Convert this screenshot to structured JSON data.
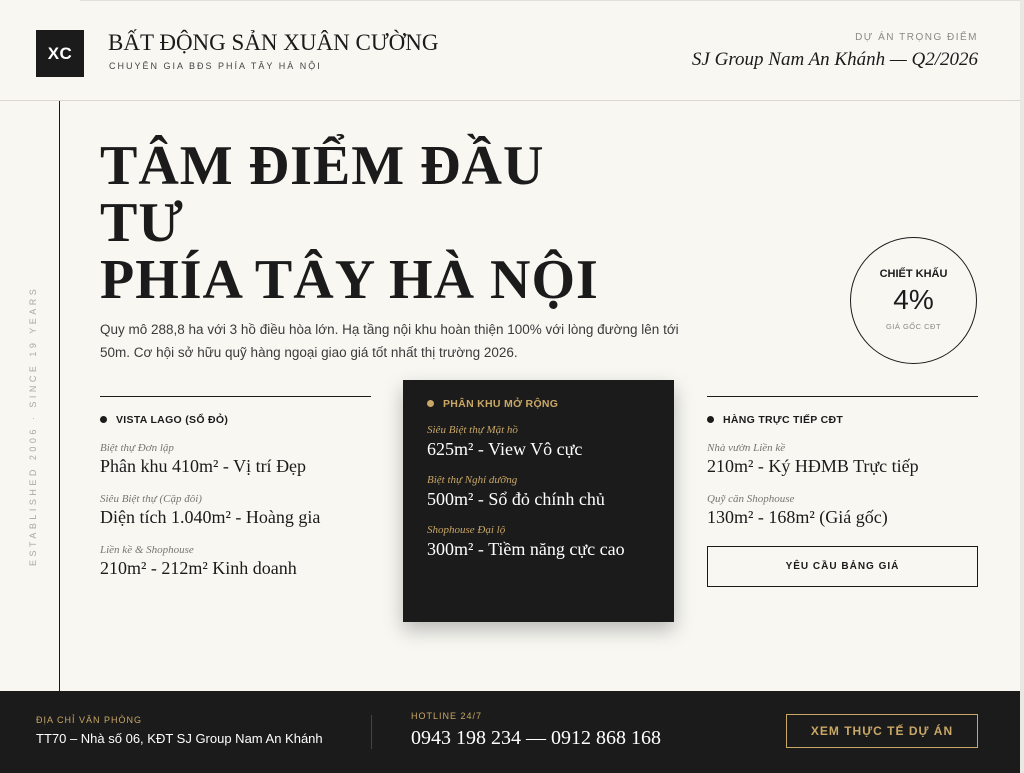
{
  "header": {
    "logo_text": "XC",
    "brand_title": "BẤT ĐỘNG SẢN XUÂN CƯỜNG",
    "brand_subtitle": "CHUYÊN GIA BĐS PHÍA TÂY HÀ NỘI",
    "project_label": "DỰ ÁN TRỌNG ĐIỂM",
    "project_name": "SJ Group Nam An Khánh — Q2/2026"
  },
  "side_text": "ESTABLISHED 2006 · SINCE 19 YEARS",
  "hero": {
    "title_line1": "TÂM ĐIỂM ĐẦU",
    "title_line2": "TƯ",
    "title_line3": "PHÍA TÂY HÀ NỘI",
    "description": "Quy mô 288,8 ha với 3 hồ điều hòa lớn. Hạ tầng nội khu hoàn thiện 100% với lòng đường lên tới 50m. Cơ hội sở hữu quỹ hàng ngoại giao giá tốt nhất thị trường 2026."
  },
  "discount": {
    "label": "CHIẾT KHẤU",
    "value": "4%",
    "note": "GIÁ GỐC CĐT"
  },
  "columns": {
    "left": {
      "heading": "VISTA LAGO (SỔ ĐỎ)",
      "items": [
        {
          "label": "Biệt thự Đơn lập",
          "value": "Phân khu 410m² - Vị trí Đẹp"
        },
        {
          "label": "Siêu Biệt thự (Cặp đôi)",
          "value": "Diện tích 1.040m² - Hoàng gia"
        },
        {
          "label": "Liền kề & Shophouse",
          "value": "210m² - 212m² Kinh doanh"
        }
      ]
    },
    "middle": {
      "heading": "PHÂN KHU MỞ RỘNG",
      "items": [
        {
          "label": "Siêu Biệt thự Mặt hồ",
          "value": "625m² - View Vô cực"
        },
        {
          "label": "Biệt thự Nghỉ dưỡng",
          "value": "500m² - Sổ đỏ chính chủ"
        },
        {
          "label": "Shophouse Đại lộ",
          "value": "300m² - Tiềm năng cực cao"
        }
      ]
    },
    "right": {
      "heading": "HÀNG TRỰC TIẾP CĐT",
      "items": [
        {
          "label": "Nhà vườn Liền kề",
          "value": "210m² - Ký HĐMB Trực tiếp"
        },
        {
          "label": "Quỹ căn Shophouse",
          "value": "130m² - 168m² (Giá gốc)"
        }
      ],
      "button_label": "YÊU CẦU BẢNG GIÁ"
    }
  },
  "footer": {
    "address_label": "ĐỊA CHỈ VĂN PHÒNG",
    "address": "TT70 – Nhà số 06, KĐT SJ Group Nam An Khánh",
    "hotline_label": "HOTLINE 24/7",
    "hotline": "0943 198 234 — 0912 868 168",
    "cta_label": "XEM THỰC TẾ DỰ ÁN"
  },
  "colors": {
    "dark": "#1b1b1b",
    "gold": "#c9a766",
    "background": "#f8f7f2"
  }
}
